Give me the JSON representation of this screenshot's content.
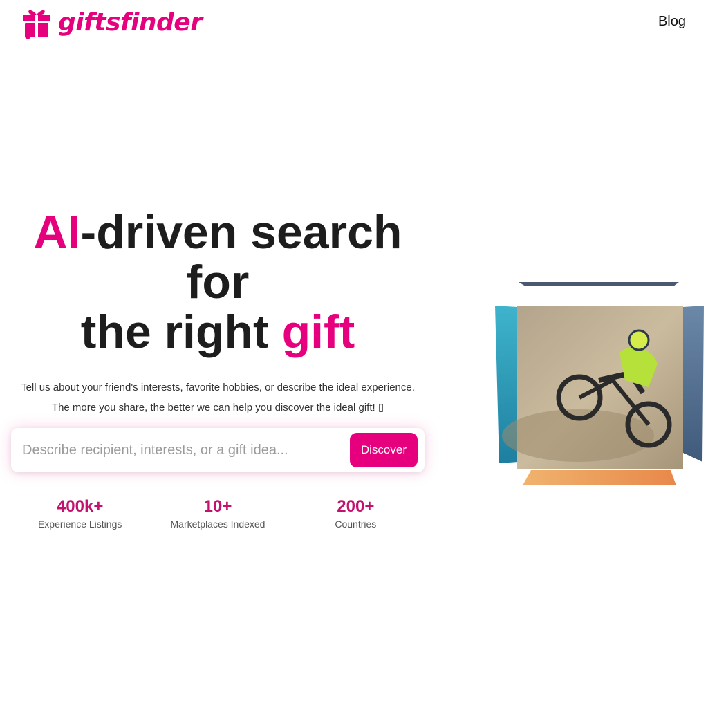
{
  "brand": {
    "name": "giftsfinder",
    "logo_icon": "gift-box-icon",
    "color": "#e6007e"
  },
  "nav": {
    "blog_label": "Blog"
  },
  "hero": {
    "title_accent_1": "AI",
    "title_part_1": "-driven search for",
    "title_part_2": "the right ",
    "title_accent_2": "gift",
    "subtitle": "Tell us about your friend's interests, favorite hobbies, or describe the ideal experience. The more you share, the better we can help you discover the ideal gift! ▯"
  },
  "search": {
    "placeholder": "Describe recipient, interests, or a gift idea...",
    "value": "",
    "button_label": "Discover"
  },
  "stats": [
    {
      "value": "400k+",
      "label": "Experience Listings"
    },
    {
      "value": "10+",
      "label": "Marketplaces Indexed"
    },
    {
      "value": "200+",
      "label": "Countries"
    }
  ],
  "showcase": {
    "image": "motocross-rider-photo-cube"
  },
  "colors": {
    "accent": "#e6007e",
    "stat_value": "#c3126e",
    "text": "#1d1d1d"
  }
}
